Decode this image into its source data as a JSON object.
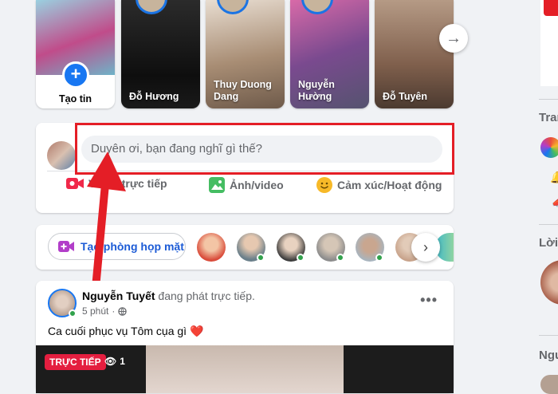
{
  "stories": {
    "create_label": "Tạo tin",
    "items": [
      {
        "name": "Đỗ Hương"
      },
      {
        "name": "Thuy Duong Dang"
      },
      {
        "name": "Nguyễn Hường"
      },
      {
        "name": "Đỗ Tuyên"
      }
    ]
  },
  "composer": {
    "placeholder": "Duyên ơi, bạn đang nghĩ gì thế?",
    "actions": [
      {
        "label": "Video trực tiếp",
        "icon": "video-icon",
        "color": "#f02849"
      },
      {
        "label": "Ảnh/video",
        "icon": "photo-icon",
        "color": "#45bd62"
      },
      {
        "label": "Cảm xúc/Hoạt động",
        "icon": "emoji-icon",
        "color": "#f7b928"
      }
    ]
  },
  "rooms": {
    "create_label": "Tạo phòng họp mặt",
    "icon": "video-plus-icon"
  },
  "post": {
    "author": "Nguyễn Tuyết",
    "action": "đang phát trực tiếp.",
    "time": "5 phút",
    "text": "Ca cuối phục vụ Tôm cụa gì ❤️",
    "live_badge": "TRỰC TIẾP",
    "viewers": "1"
  },
  "right_sidebar": {
    "label_1": "Tran",
    "label_2": "Lời",
    "label_3": "Ngu"
  },
  "colors": {
    "accent": "#1877f2",
    "highlight": "#e41e26",
    "live": "#e41e3f"
  }
}
